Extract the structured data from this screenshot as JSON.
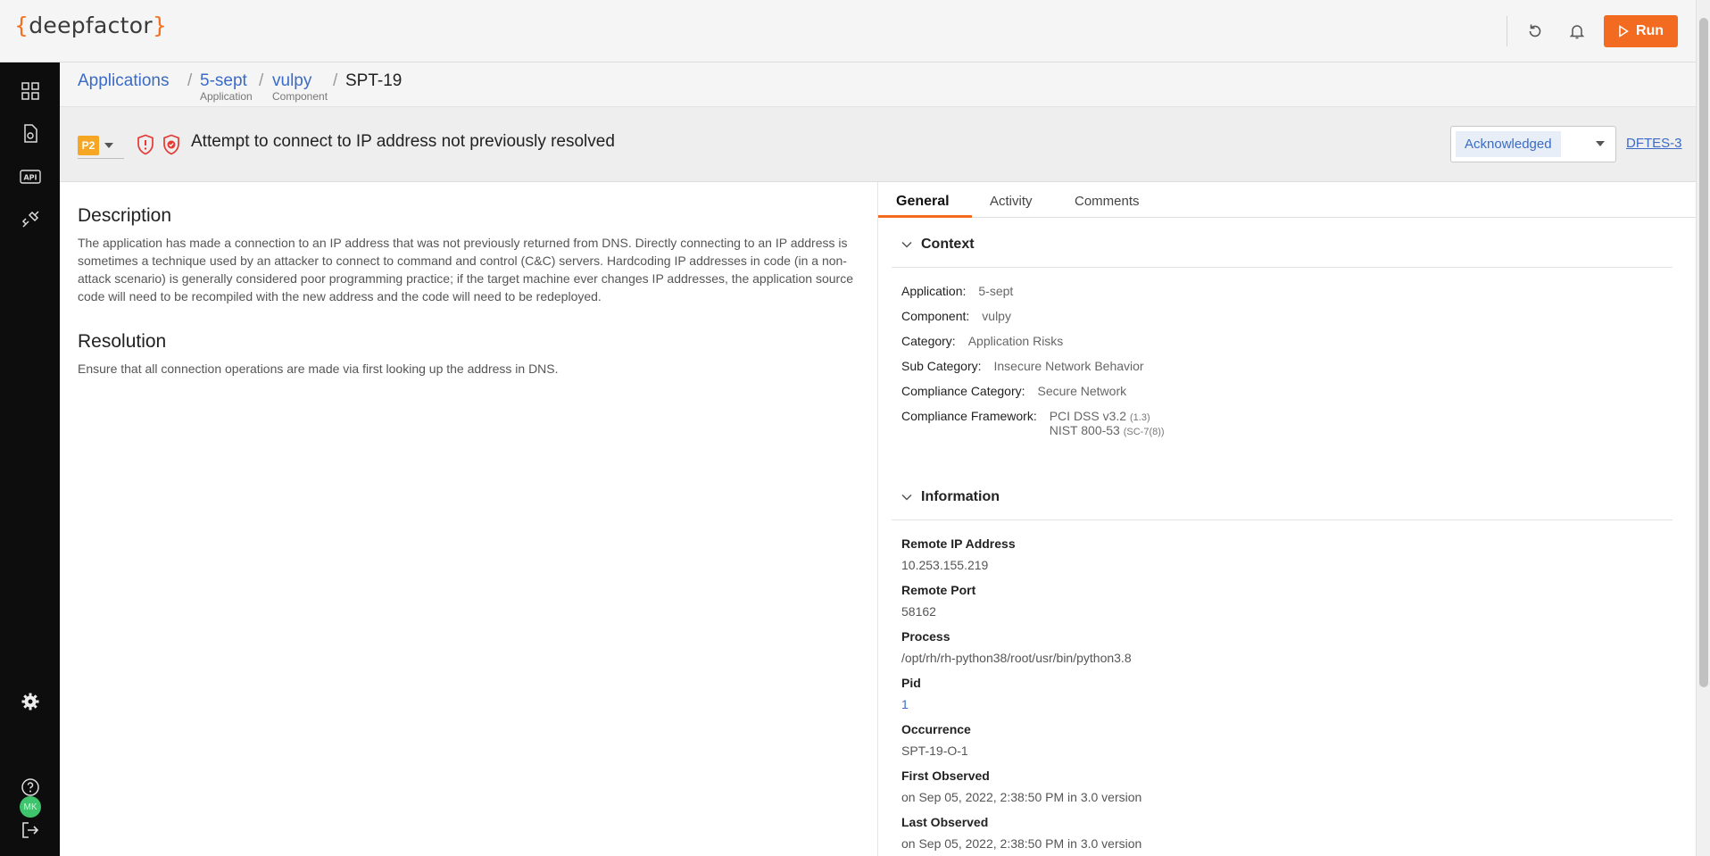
{
  "app": {
    "logo_open": "{",
    "logo_text": "deepfactor",
    "logo_close": "}",
    "run_label": "Run",
    "accent": "#f26b21"
  },
  "sidebar": {
    "items": [
      {
        "icon": "dashboard-icon"
      },
      {
        "icon": "file-icon"
      },
      {
        "icon": "api-icon"
      },
      {
        "icon": "integrations-icon"
      }
    ],
    "bottom": [
      {
        "icon": "gear-icon"
      },
      {
        "icon": "avatar",
        "initials": "MK"
      },
      {
        "icon": "help-icon"
      },
      {
        "icon": "logout-icon"
      }
    ]
  },
  "breadcrumb": {
    "items": [
      {
        "label": "Applications",
        "sub": ""
      },
      {
        "label": "5-sept",
        "sub": "Application"
      },
      {
        "label": "vulpy",
        "sub": "Component"
      }
    ],
    "separator": "/",
    "current": "SPT-19"
  },
  "issue": {
    "priority": "P2",
    "title": "Attempt to connect to IP address not previously resolved",
    "status": "Acknowledged",
    "ticket": "DFTES-3"
  },
  "description": {
    "heading": "Description",
    "text": "The application has made a connection to an IP address that was not previously returned from DNS. Directly connecting to an IP address is sometimes a technique used by an attacker to connect to command and control (C&C) servers. Hardcoding IP addresses in code (in a non-attack scenario) is generally considered poor programming practice; if the target machine ever changes IP addresses, the application source code will need to be recompiled with the new address and the code will need to be redeployed."
  },
  "resolution": {
    "heading": "Resolution",
    "text": "Ensure that all connection operations are made via first looking up the address in DNS."
  },
  "tabs": [
    "General",
    "Activity",
    "Comments"
  ],
  "context": {
    "heading": "Context",
    "rows": [
      {
        "k": "Application:",
        "v": "5-sept"
      },
      {
        "k": "Component:",
        "v": "vulpy"
      },
      {
        "k": "Category:",
        "v": "Application Risks"
      },
      {
        "k": "Sub Category:",
        "v": "Insecure Network Behavior"
      },
      {
        "k": "Compliance Category:",
        "v": "Secure Network"
      }
    ],
    "framework_label": "Compliance Framework:",
    "frameworks": [
      {
        "name": "PCI DSS v3.2",
        "ref": "(1.3)"
      },
      {
        "name": "NIST 800-53",
        "ref": "(SC-7(8))"
      }
    ]
  },
  "information": {
    "heading": "Information",
    "rows": [
      {
        "k": "Remote IP Address",
        "v": "10.253.155.219"
      },
      {
        "k": "Remote Port",
        "v": "58162"
      },
      {
        "k": "Process",
        "v": "/opt/rh/rh-python38/root/usr/bin/python3.8"
      },
      {
        "k": "Pid",
        "v": "1"
      },
      {
        "k": "Occurrence",
        "v": "SPT-19-O-1"
      },
      {
        "k": "First Observed",
        "v": "on Sep 05, 2022, 2:38:50 PM in 3.0 version"
      },
      {
        "k": "Last Observed",
        "v": "on Sep 05, 2022, 2:38:50 PM in 3.0 version"
      }
    ]
  }
}
